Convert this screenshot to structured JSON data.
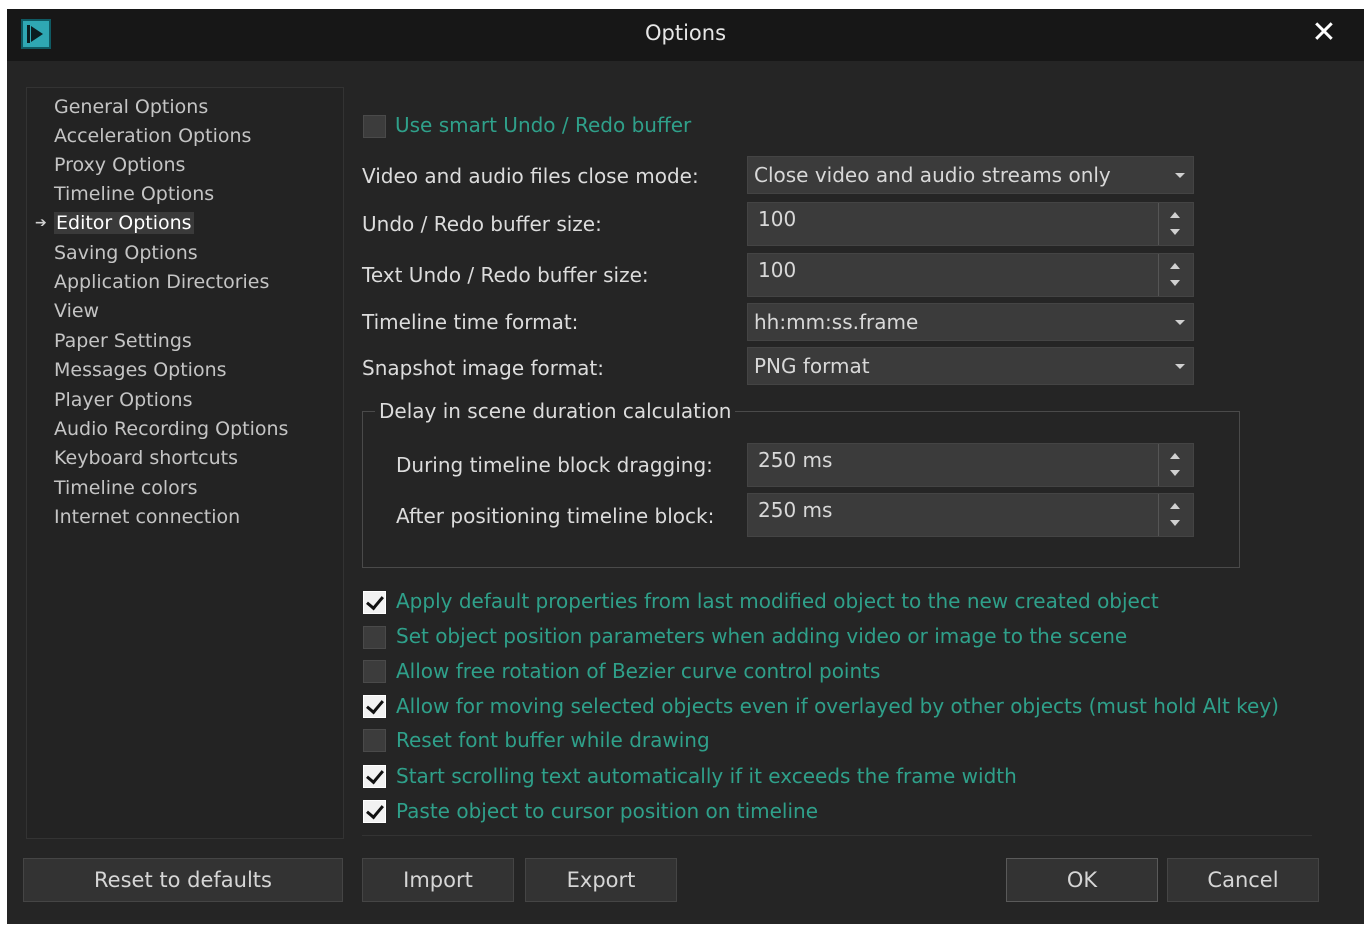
{
  "window": {
    "title": "Options",
    "close_symbol": "✕",
    "app_icon": "play-icon"
  },
  "nav": {
    "items": [
      "General Options",
      "Acceleration Options",
      "Proxy Options",
      "Timeline Options",
      "Editor Options",
      "Saving Options",
      "Application Directories",
      "View",
      "Paper Settings",
      "Messages Options",
      "Player Options",
      "Audio Recording Options",
      "Keyboard shortcuts",
      "Timeline colors",
      "Internet connection"
    ],
    "selected": "Editor Options",
    "selected_marker": "➔"
  },
  "editor": {
    "smart_undo": {
      "label": "Use smart Undo / Redo buffer",
      "checked": false
    },
    "close_mode": {
      "label": "Video and audio files close mode:",
      "value": "Close video and audio streams only"
    },
    "undo_size": {
      "label": "Undo / Redo buffer size:",
      "value": "100"
    },
    "text_undo_size": {
      "label": "Text Undo / Redo buffer size:",
      "value": "100"
    },
    "time_format": {
      "label": "Timeline time format:",
      "value": "hh:mm:ss.frame"
    },
    "snapshot_format": {
      "label": "Snapshot image format:",
      "value": "PNG format"
    },
    "delay_group": {
      "title": "Delay in scene duration calculation",
      "dragging": {
        "label": "During timeline block dragging:",
        "value": "250 ms"
      },
      "positioning": {
        "label": "After positioning timeline block:",
        "value": "250 ms"
      }
    },
    "checkboxes": [
      {
        "label": "Apply default properties from last modified object to the new created object",
        "checked": true
      },
      {
        "label": "Set object position parameters when adding video or image to the scene",
        "checked": false
      },
      {
        "label": "Allow free rotation of Bezier curve control points",
        "checked": false
      },
      {
        "label": "Allow for moving selected objects even if overlayed by other objects (must hold Alt key)",
        "checked": true
      },
      {
        "label": "Reset font buffer while drawing",
        "checked": false
      },
      {
        "label": "Start scrolling text automatically if it exceeds the frame width",
        "checked": true
      },
      {
        "label": "Paste object to cursor position on timeline",
        "checked": true
      }
    ]
  },
  "buttons": {
    "reset": "Reset to defaults",
    "import": "Import",
    "export": "Export",
    "ok": "OK",
    "cancel": "Cancel"
  },
  "colors": {
    "background": "#252525",
    "titlebar": "#171717",
    "accent_text": "#2fa08a",
    "app_icon": "#2fa7b3"
  }
}
